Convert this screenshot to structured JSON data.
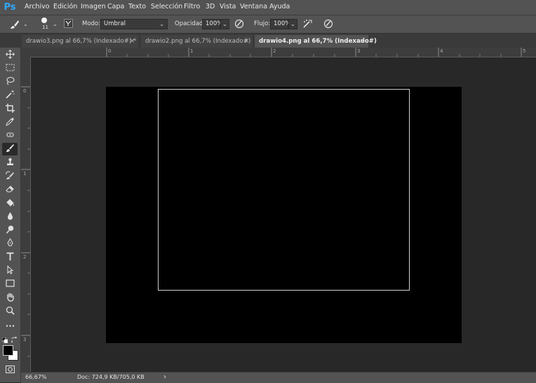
{
  "app": {
    "logo": "Ps"
  },
  "menu": [
    "Archivo",
    "Edición",
    "Imagen",
    "Capa",
    "Texto",
    "Selección",
    "Filtro",
    "3D",
    "Vista",
    "Ventana",
    "Ayuda"
  ],
  "options": {
    "brush_size": "11",
    "mode_label": "Modo:",
    "mode_value": "Umbral",
    "opacity_label": "Opacidad:",
    "opacity_value": "100%",
    "flow_label": "Flujo:",
    "flow_value": "100%"
  },
  "tabs": [
    {
      "label": "drawio3.png al 66,7% (Indexado#) *",
      "close": "×"
    },
    {
      "label": "drawio2.png al 66,7% (Indexado#)",
      "close": "×"
    },
    {
      "label": "drawio4.png al 66,7% (Indexado#)",
      "close": "×"
    }
  ],
  "ruler": {
    "h_labels": [
      "0",
      "1",
      "2",
      "3",
      "4",
      "5"
    ],
    "v_labels": [
      "0",
      "1",
      "2",
      "3"
    ]
  },
  "status": {
    "zoom": "66,67%",
    "doc": "Doc: 724,9 KB/705,0 KB",
    "arrow": "›"
  },
  "colors": {
    "ui_panel": "#535353",
    "canvas_bg": "#282828",
    "document": "#000000",
    "ps_blue": "#31a8ff"
  }
}
